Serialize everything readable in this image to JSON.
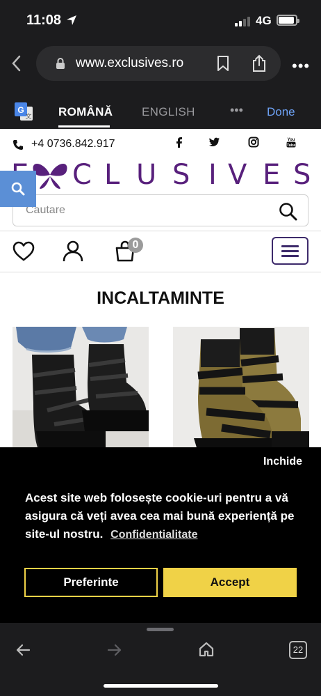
{
  "status_bar": {
    "time": "11:08",
    "network": "4G"
  },
  "browser": {
    "url": "www.exclusives.ro",
    "more_label": "•••"
  },
  "translate_bar": {
    "lang_active": "ROMÂNĂ",
    "lang_other": "ENGLISH",
    "more_label": "•••",
    "done_label": "Done"
  },
  "site": {
    "phone": "+4 0736.842.917",
    "logo_letters": [
      "E",
      "X",
      "C",
      "L",
      "U",
      "S",
      "I",
      "V",
      "E",
      "S"
    ],
    "search": {
      "placeholder": "Cautare"
    },
    "cart_count": "0",
    "page_title": "INCALTAMINTE",
    "brand_color": "#58207c"
  },
  "cookie_banner": {
    "close_label": "Inchide",
    "message": "Acest site web folosește cookie-uri pentru a vă asigura că veți avea cea mai bună experiență pe site-ul nostru.",
    "link_label": "Confidentialitate",
    "preferences_label": "Preferinte",
    "accept_label": "Accept",
    "accent_color": "#f0d247"
  },
  "toolbar": {
    "tabs_count": "22"
  }
}
